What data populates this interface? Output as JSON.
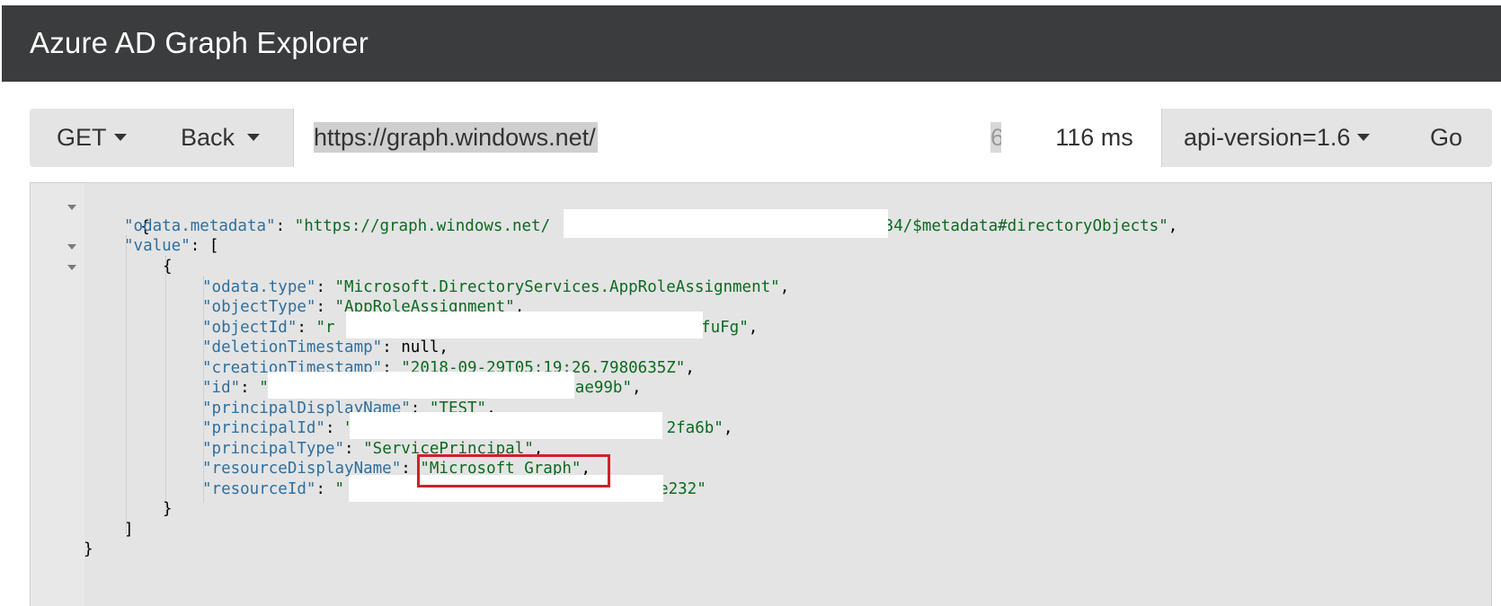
{
  "app": {
    "title": "Azure AD Graph Explorer"
  },
  "toolbar": {
    "method_label": "GET",
    "back_label": "Back",
    "url_value": "https://graph.windows.net/",
    "url_tail": "6",
    "timing": "116 ms",
    "api_version_label": "api-version=1.6",
    "go_label": "Go"
  },
  "json": {
    "open_brace": "{",
    "close_brace": "}",
    "open_bracket_close": "]",
    "metadata_key": "\"odata.metadata\"",
    "metadata_value_start": "\"https://graph.windows.net/",
    "metadata_value_end": "634/$metadata#directoryObjects\"",
    "value_key": "\"value\"",
    "open_bracket": "[",
    "obj_open": "{",
    "obj_close": "}",
    "fields": [
      {
        "key": "\"odata.type\"",
        "value": "\"Microsoft.DirectoryServices.AppRoleAssignment\"",
        "trail": ","
      },
      {
        "key": "\"objectType\"",
        "value": "\"AppRoleAssignment\"",
        "trail": ","
      },
      {
        "key": "\"objectId\"",
        "value_start": "\"r",
        "value_end": "AfuFg\"",
        "trail": ","
      },
      {
        "key": "\"deletionTimestamp\"",
        "value": "null",
        "trail": ","
      },
      {
        "key": "\"creationTimestamp\"",
        "value": "\"2018-09-29T05:19:26.7980635Z\"",
        "trail": ","
      },
      {
        "key": "\"id\"",
        "value_start": "\"",
        "value_end": "ae99b\"",
        "trail": ","
      },
      {
        "key": "\"principalDisplayName\"",
        "value": "\"TEST\"",
        "trail": ","
      },
      {
        "key": "\"principalId\"",
        "value_start": "\"",
        "value_end": "2fa6b\"",
        "trail": ","
      },
      {
        "key": "\"principalType\"",
        "value": "\"ServicePrincipal\"",
        "trail": ","
      },
      {
        "key": "\"resourceDisplayName\"",
        "value": "\"Microsoft Graph\"",
        "trail": ","
      },
      {
        "key": "\"resourceId\"",
        "value_start": "\"",
        "value_end": "e232\"",
        "trail": ""
      }
    ]
  },
  "colors": {
    "titlebar_bg": "#3b3c3d",
    "json_key": "#2f6f9f",
    "json_string": "#0b6a1f",
    "highlight_border": "#d11f2a"
  }
}
